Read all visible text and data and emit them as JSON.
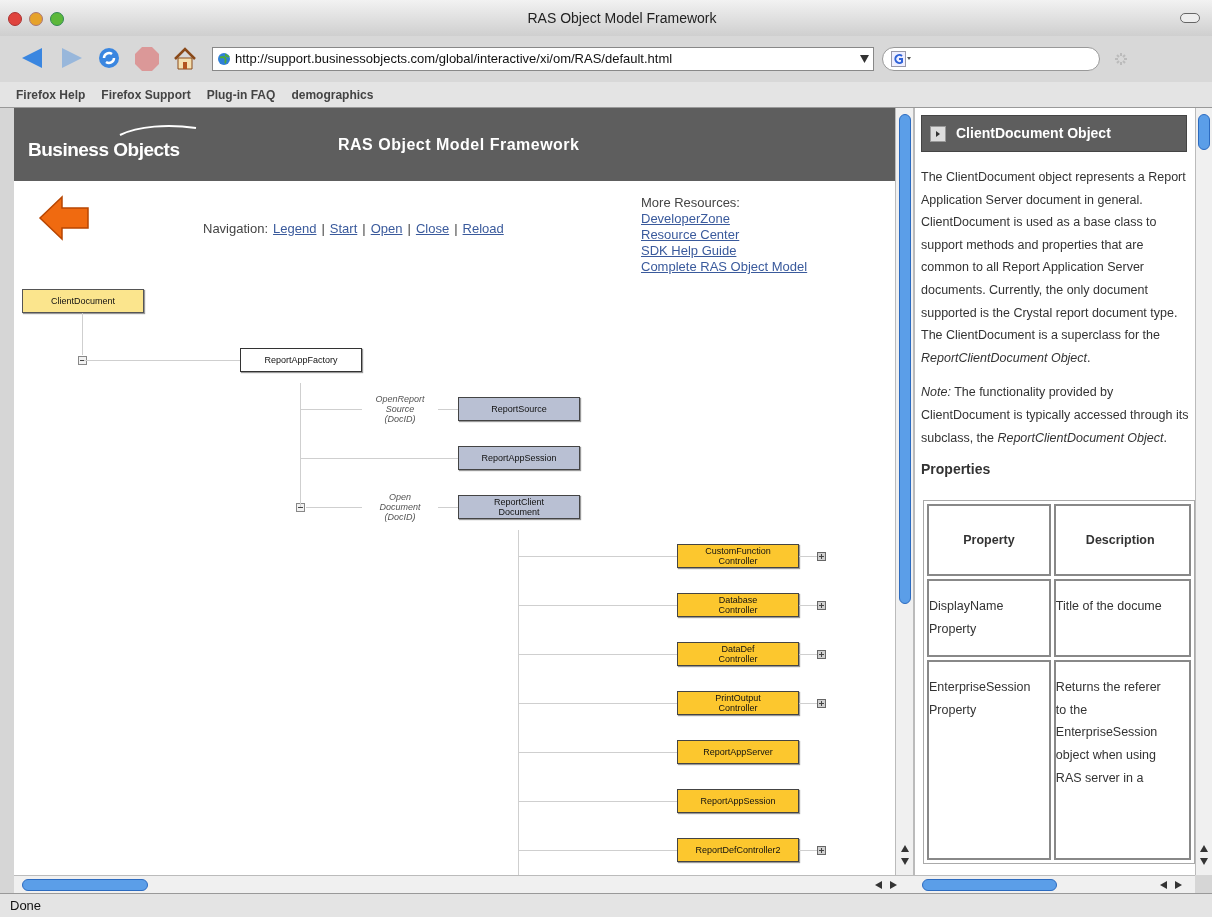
{
  "window": {
    "title": "RAS Object Model Framework"
  },
  "toolbar": {
    "buttons": [
      {
        "kind": "back",
        "disabled": false
      },
      {
        "kind": "forward",
        "disabled": true
      },
      {
        "kind": "reload",
        "disabled": false
      },
      {
        "kind": "stop",
        "disabled": true
      },
      {
        "kind": "home",
        "disabled": false
      }
    ],
    "url": "http://support.businessobjects.com/global/interactive/xi/om/RAS/default.html"
  },
  "bookmarks": [
    "Firefox Help",
    "Firefox Support",
    "Plug-in FAQ",
    "demographics"
  ],
  "left_frame": {
    "logo": "Business Objects",
    "title": "RAS Object Model Framework",
    "navigation": {
      "label": "Navigation:",
      "items": [
        {
          "kind": "link",
          "text": "Legend"
        },
        {
          "kind": "separator",
          "text": "|"
        },
        {
          "kind": "link",
          "text": "Start"
        },
        {
          "kind": "separator",
          "text": "|"
        },
        {
          "kind": "link",
          "text": "Open"
        },
        {
          "kind": "separator",
          "text": "|"
        },
        {
          "kind": "link",
          "text": "Close"
        },
        {
          "kind": "separator",
          "text": "|"
        },
        {
          "kind": "link",
          "text": "Reload"
        }
      ]
    },
    "resources": {
      "heading": "More Resources:",
      "links": [
        "DeveloperZone",
        "Resource Center",
        "SDK Help Guide",
        "Complete RAS Object Model"
      ]
    },
    "diagram": {
      "root": {
        "label": "ClientDocument",
        "kind": "root",
        "expanded": true,
        "children": [
          {
            "label": "ReportAppFactory",
            "kind": "factory",
            "children": [
              {
                "label": "ReportSource",
                "kind": "object",
                "edge_label": "OpenReport\nSource\n(DocID)"
              },
              {
                "label": "ReportAppSession",
                "kind": "object"
              },
              {
                "label": "ReportClient\nDocument",
                "kind": "object",
                "edge_label": "Open\nDocument\n(DocID)",
                "expanded": true,
                "children": [
                  {
                    "label": "CustomFunction\nController",
                    "kind": "controller",
                    "expanded": false
                  },
                  {
                    "label": "Database\nController",
                    "kind": "controller",
                    "expanded": false
                  },
                  {
                    "label": "DataDef\nController",
                    "kind": "controller",
                    "expanded": false
                  },
                  {
                    "label": "PrintOutput\nController",
                    "kind": "controller",
                    "expanded": false
                  },
                  {
                    "label": "ReportAppServer",
                    "kind": "controller"
                  },
                  {
                    "label": "ReportAppSession",
                    "kind": "controller"
                  },
                  {
                    "label": "ReportDefController2",
                    "kind": "controller",
                    "expanded": false
                  }
                ]
              }
            ]
          }
        ]
      }
    }
  },
  "right_frame": {
    "heading": "ClientDocument Object",
    "paragraphs": [
      "The ClientDocument object represents a Report Application Server document in general. ClientDocument is used as a base class to support methods and properties that are common to all Report Application Server documents. Currently, the only document supported is the Crystal report document type. The ClientDocument is a superclass for the *ReportClientDocument Object*.",
      "*Note:* The functionality provided by ClientDocument is typically accessed through its subclass, the *ReportClientDocument Object*."
    ],
    "section": "Properties",
    "table": {
      "columns": [
        "Property",
        "Description"
      ],
      "rows": [
        [
          "DisplayName\nProperty",
          "Title of the docume"
        ],
        [
          "EnterpriseSession\nProperty",
          "Returns the referer\nto the\nEnterpriseSession\nobject when using\nRAS server in a"
        ]
      ]
    }
  },
  "status_bar": "Done"
}
